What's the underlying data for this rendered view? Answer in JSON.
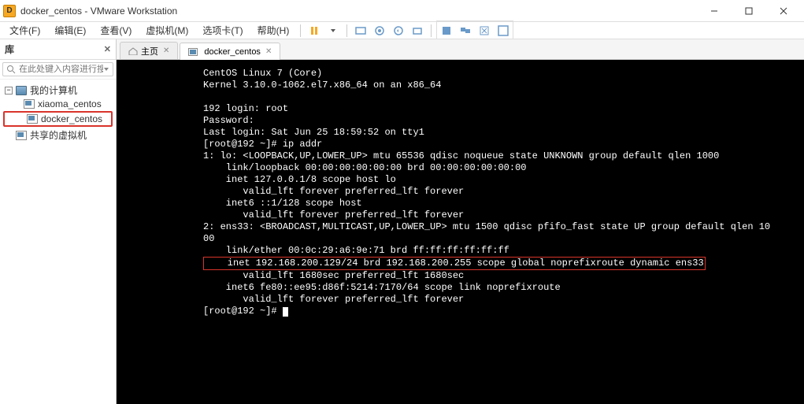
{
  "window": {
    "title": "docker_centos - VMware Workstation"
  },
  "menu": {
    "file": "文件(F)",
    "edit": "编辑(E)",
    "view": "查看(V)",
    "vm": "虚拟机(M)",
    "tabs": "选项卡(T)",
    "help": "帮助(H)"
  },
  "sidebar": {
    "header": "库",
    "search_placeholder": "在此处键入内容进行搜…",
    "root": "我的计算机",
    "items": [
      {
        "label": "xiaoma_centos"
      },
      {
        "label": "docker_centos"
      }
    ],
    "shared": "共享的虚拟机"
  },
  "tabs": {
    "home": "主页",
    "active": "docker_centos"
  },
  "terminal": {
    "line1": "CentOS Linux 7 (Core)",
    "line2": "Kernel 3.10.0-1062.el7.x86_64 on an x86_64",
    "line3": "192 login: root",
    "line4": "Password:",
    "line5": "Last login: Sat Jun 25 18:59:52 on tty1",
    "line6": "[root@192 ~]# ip addr",
    "line7": "1: lo: <LOOPBACK,UP,LOWER_UP> mtu 65536 qdisc noqueue state UNKNOWN group default qlen 1000",
    "line8": "    link/loopback 00:00:00:00:00:00 brd 00:00:00:00:00:00",
    "line9": "    inet 127.0.0.1/8 scope host lo",
    "line10": "       valid_lft forever preferred_lft forever",
    "line11": "    inet6 ::1/128 scope host",
    "line12": "       valid_lft forever preferred_lft forever",
    "line13": "2: ens33: <BROADCAST,MULTICAST,UP,LOWER_UP> mtu 1500 qdisc pfifo_fast state UP group default qlen 10",
    "line13b": "00",
    "line14": "    link/ether 00:0c:29:a6:9e:71 brd ff:ff:ff:ff:ff:ff",
    "line15": "    inet 192.168.200.129/24 brd 192.168.200.255 scope global noprefixroute dynamic ens33",
    "line16": "       valid_lft 1680sec preferred_lft 1680sec",
    "line17": "    inet6 fe80::ee95:d86f:5214:7170/64 scope link noprefixroute",
    "line18": "       valid_lft forever preferred_lft forever",
    "line19": "[root@192 ~]# "
  }
}
